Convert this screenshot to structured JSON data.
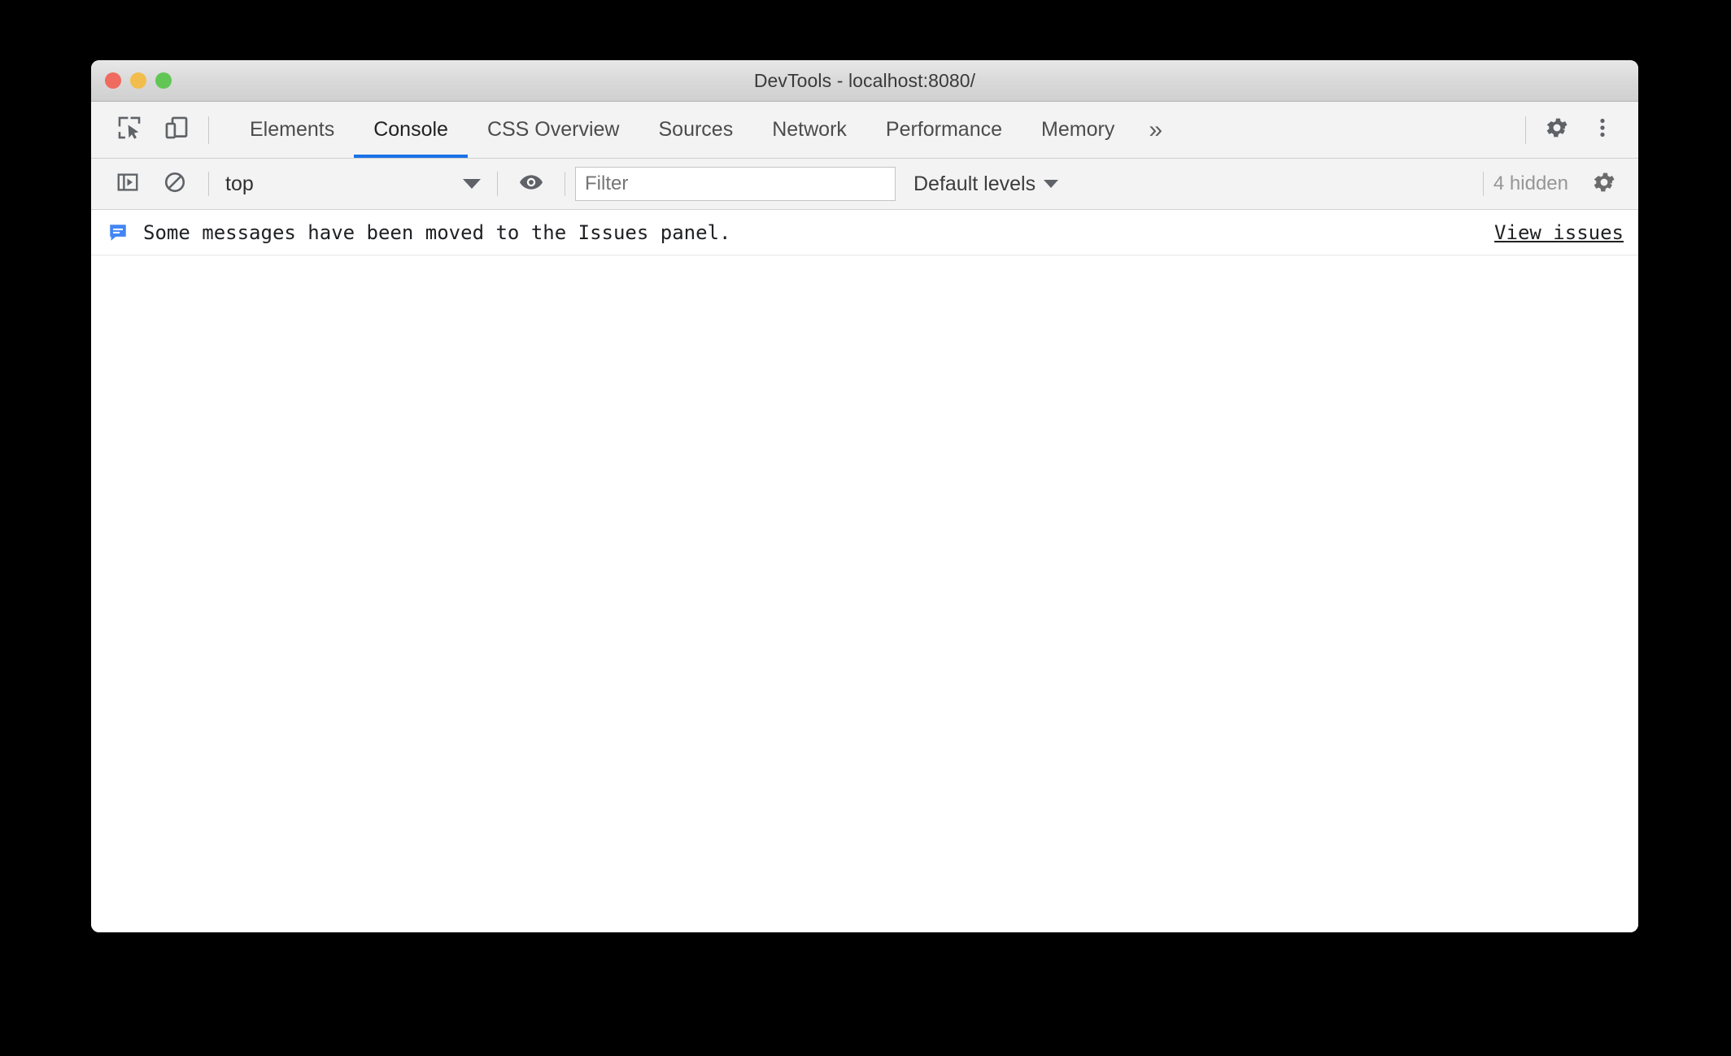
{
  "window": {
    "title": "DevTools - localhost:8080/",
    "traffic_lights": [
      {
        "name": "close",
        "color": "#ef6b5f"
      },
      {
        "name": "minimize",
        "color": "#f2bd4d"
      },
      {
        "name": "maximize",
        "color": "#62c655"
      }
    ]
  },
  "toolbar": {
    "inspect_icon": "inspect-element-icon",
    "device_icon": "device-toolbar-icon",
    "settings_icon": "gear-icon",
    "more_icon": "kebab-menu-icon",
    "overflow_label": "»"
  },
  "tabs": [
    {
      "label": "Elements",
      "active": false
    },
    {
      "label": "Console",
      "active": true
    },
    {
      "label": "CSS Overview",
      "active": false
    },
    {
      "label": "Sources",
      "active": false
    },
    {
      "label": "Network",
      "active": false
    },
    {
      "label": "Performance",
      "active": false
    },
    {
      "label": "Memory",
      "active": false
    }
  ],
  "filterbar": {
    "sidebar_toggle_icon": "console-sidebar-toggle-icon",
    "clear_icon": "clear-console-icon",
    "context": "top",
    "eye_icon": "live-expression-eye-icon",
    "filter_placeholder": "Filter",
    "filter_value": "",
    "levels": "Default levels",
    "hidden_count": "4 hidden",
    "settings_icon": "console-settings-gear-icon"
  },
  "console": {
    "messages": [
      {
        "icon": "issue-message-icon",
        "icon_color": "#4285f4",
        "text": "Some messages have been moved to the Issues panel.",
        "link": "View issues"
      }
    ]
  },
  "colors": {
    "accent": "#1a73e8",
    "issue_blue": "#4285f4",
    "toolbar_bg": "#f3f3f3",
    "titlebar_bg": "#d8d8d8"
  }
}
